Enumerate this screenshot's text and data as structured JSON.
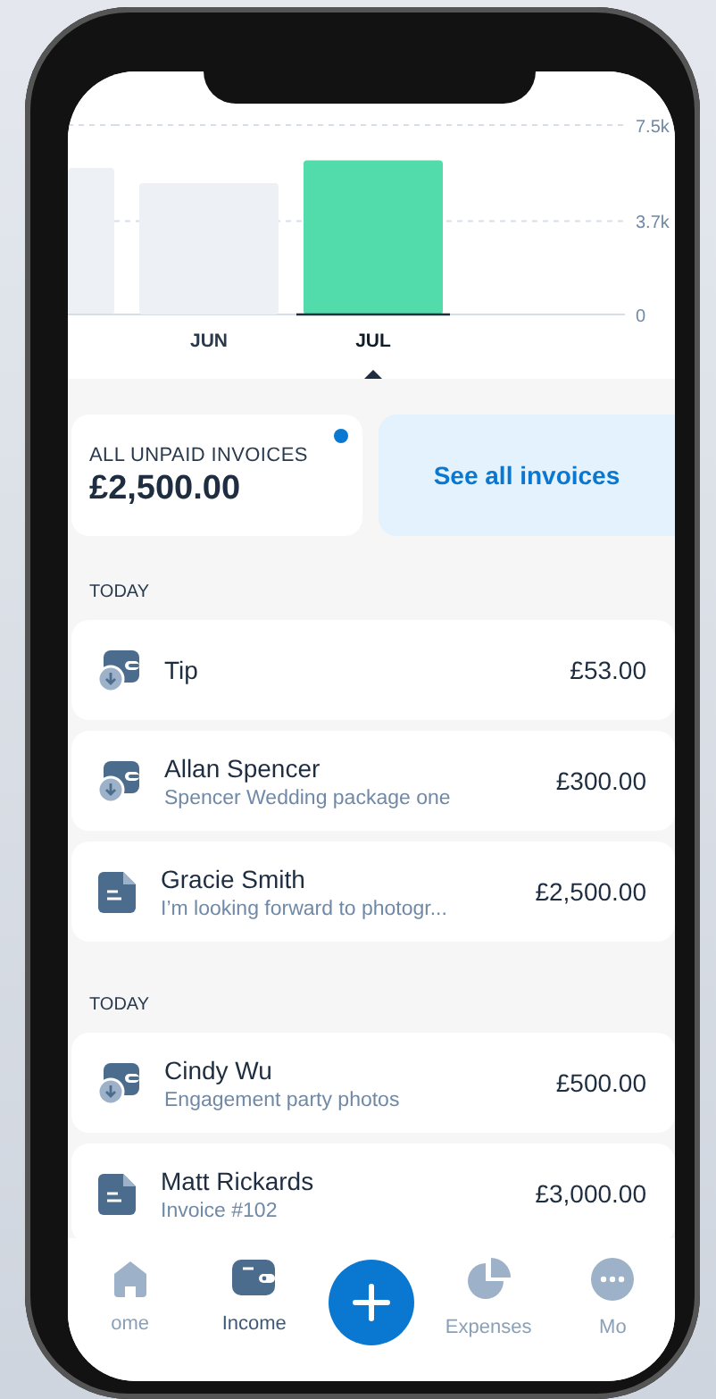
{
  "chart": {
    "chart_data": {
      "type": "bar",
      "categories": [
        "JUN",
        "JUL"
      ],
      "series": [
        {
          "values": [
            5200,
            6100
          ]
        }
      ],
      "ylim": [
        0,
        7500
      ],
      "yticks": [
        {
          "value": 0,
          "label": "0"
        },
        {
          "value": 3700,
          "label": "3.7k"
        },
        {
          "value": 7500,
          "label": "7.5k"
        }
      ]
    },
    "bars": [
      {
        "selected": false,
        "color": "#edf1f5"
      },
      {
        "selected": true,
        "color": "#52dcac"
      }
    ]
  },
  "summary": {
    "label": "ALL UNPAID INVOICES",
    "amount": "£2,500.00",
    "unread": true,
    "link": "See all invoices"
  },
  "groups": [
    {
      "header": "TODAY",
      "items": [
        {
          "kind": "payment",
          "name": "Tip",
          "amount": "£53.00"
        },
        {
          "kind": "payment",
          "name": "Allan Spencer",
          "note": "Spencer Wedding package one",
          "amount": "£300.00"
        },
        {
          "kind": "invoice",
          "name": "Gracie Smith",
          "note": "I’m looking forward to photogr...",
          "amount": "£2,500.00"
        }
      ]
    },
    {
      "header": "TODAY",
      "items": [
        {
          "kind": "payment",
          "name": "Cindy Wu",
          "note": "Engagement party photos",
          "amount": "£500.00"
        },
        {
          "kind": "invoice",
          "name": "Matt Rickards",
          "note": "Invoice #102",
          "amount": "£3,000.00"
        }
      ]
    }
  ],
  "nav": [
    {
      "kind": "home",
      "label": "ome",
      "selected": false
    },
    {
      "kind": "income",
      "label": "Income",
      "selected": true
    },
    {
      "kind": "add"
    },
    {
      "kind": "expenses",
      "label": "Expenses",
      "selected": false
    },
    {
      "kind": "more",
      "label": "Mo",
      "selected": false
    }
  ]
}
